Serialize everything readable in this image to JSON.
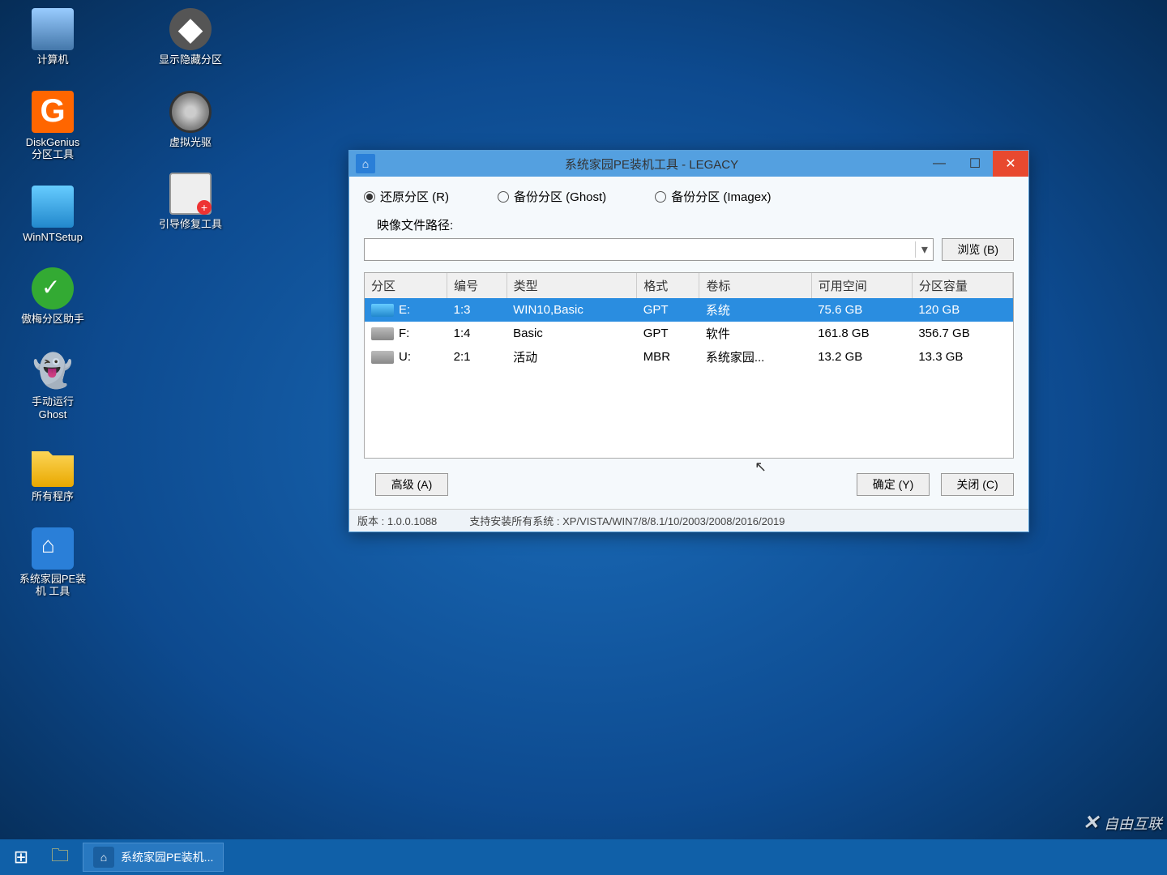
{
  "desktop": {
    "icons_col1": [
      {
        "label": "计算机",
        "name": "desktop-computer"
      },
      {
        "label": "DiskGenius\n分区工具",
        "name": "desktop-diskgenius"
      },
      {
        "label": "WinNTSetup",
        "name": "desktop-winntsetup"
      },
      {
        "label": "傲梅分区助手",
        "name": "desktop-aomei"
      },
      {
        "label": "手动运行\nGhost",
        "name": "desktop-ghost"
      },
      {
        "label": "所有程序",
        "name": "desktop-all-programs"
      },
      {
        "label": "系统家园PE装\n机 工具",
        "name": "desktop-pe-tool"
      }
    ],
    "icons_col2": [
      {
        "label": "显示隐藏分区",
        "name": "desktop-show-hidden"
      },
      {
        "label": "虚拟光驱",
        "name": "desktop-virtual-cd"
      },
      {
        "label": "引导修复工具",
        "name": "desktop-boot-repair"
      }
    ]
  },
  "window": {
    "title": "系统家园PE装机工具 - LEGACY",
    "radio_restore": "还原分区 (R)",
    "radio_backup_ghost": "备份分区 (Ghost)",
    "radio_backup_imagex": "备份分区 (Imagex)",
    "path_label": "映像文件路径:",
    "browse": "浏览 (B)",
    "table": {
      "headers": [
        "分区",
        "编号",
        "类型",
        "格式",
        "卷标",
        "可用空间",
        "分区容量"
      ],
      "rows": [
        {
          "drive": "E:",
          "no": "1:3",
          "type": "WIN10,Basic",
          "fmt": "GPT",
          "vol": "系统",
          "free": "75.6 GB",
          "cap": "120 GB",
          "selected": true
        },
        {
          "drive": "F:",
          "no": "1:4",
          "type": "Basic",
          "fmt": "GPT",
          "vol": "软件",
          "free": "161.8 GB",
          "cap": "356.7 GB",
          "selected": false
        },
        {
          "drive": "U:",
          "no": "2:1",
          "type": "活动",
          "fmt": "MBR",
          "vol": "系统家园...",
          "free": "13.2 GB",
          "cap": "13.3 GB",
          "selected": false
        }
      ]
    },
    "advanced": "高级 (A)",
    "ok": "确定 (Y)",
    "close": "关闭 (C)",
    "status_version": "版本 : 1.0.0.1088",
    "status_support": "支持安装所有系统 : XP/VISTA/WIN7/8/8.1/10/2003/2008/2016/2019"
  },
  "taskbar": {
    "task_label": "系统家园PE装机..."
  },
  "watermark": "自由互联"
}
